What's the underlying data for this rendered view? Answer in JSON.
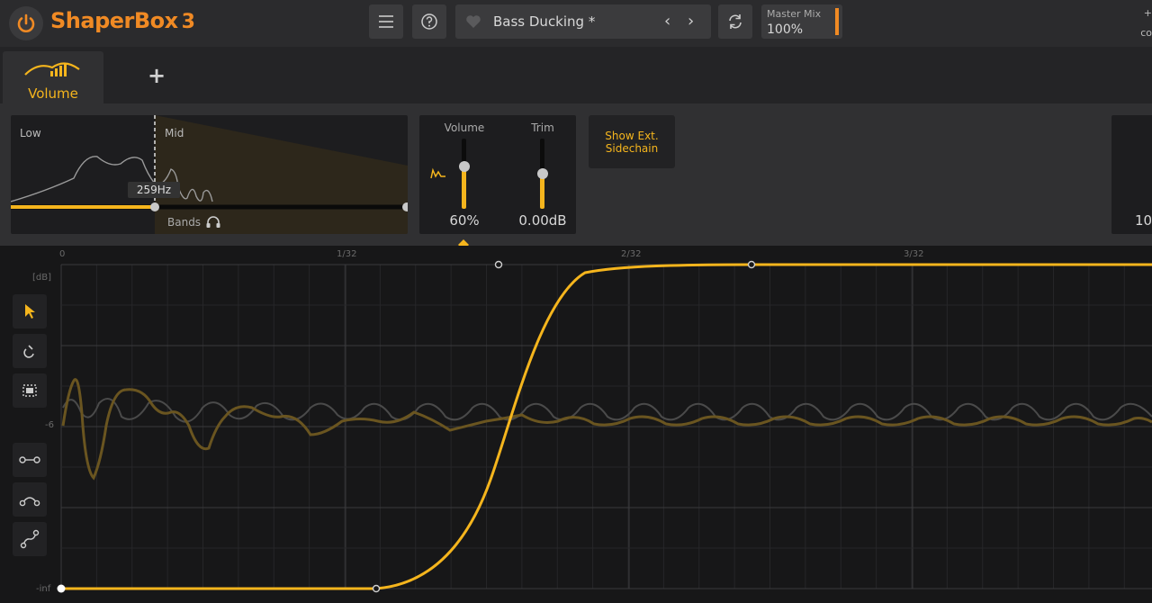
{
  "app": {
    "brand_name": "ShaperBox",
    "brand_version": "3",
    "accent_color": "#f5b51d",
    "brand_color": "#f08a24"
  },
  "topbar": {
    "menu_icon": "hamburger-menu-icon",
    "help_icon": "question-icon",
    "preset": {
      "name": "Bass Ducking *",
      "favorite_icon": "heart-icon",
      "prev": "‹",
      "next": "›"
    },
    "undo_icon": "refresh-icon",
    "master_mix": {
      "label": "Master Mix",
      "value": "100%"
    },
    "right_cut_text": "+\nco"
  },
  "tabs": {
    "items": [
      {
        "label": "Volume",
        "icon": "volume-shaper-icon",
        "active": true
      }
    ],
    "add_label": "+"
  },
  "bands": {
    "low_label": "Low",
    "mid_label": "Mid",
    "crossover_freq": "259Hz",
    "bands_label": "Bands",
    "headphones_icon": "headphones-icon"
  },
  "volume": {
    "volume_label": "Volume",
    "volume_value": "60%",
    "volume_level": 0.6,
    "trim_label": "Trim",
    "trim_value": "0.00dB",
    "trim_level": 0.5,
    "lfo_icon": "lfo-wave-icon"
  },
  "sidechain": {
    "label_line1": "Show Ext.",
    "label_line2": "Sidechain"
  },
  "right_panel": {
    "value": "10"
  },
  "graph": {
    "x_labels": [
      "0",
      "1/32",
      "2/32",
      "3/32"
    ],
    "y_unit": "[dB]",
    "y_mid": "-6",
    "y_bottom": "-inf",
    "tools": [
      {
        "name": "pointer-tool",
        "icon": "cursor-icon",
        "active": true
      },
      {
        "name": "pencil-tool",
        "icon": "magnet-icon",
        "active": false
      },
      {
        "name": "select-tool",
        "icon": "select-box-icon",
        "active": false
      },
      {
        "name": "line-tool",
        "icon": "line-node-icon",
        "active": false
      },
      {
        "name": "curve-tool",
        "icon": "curve-node-icon",
        "active": false
      },
      {
        "name": "scurve-tool",
        "icon": "s-curve-icon",
        "active": false
      }
    ]
  }
}
